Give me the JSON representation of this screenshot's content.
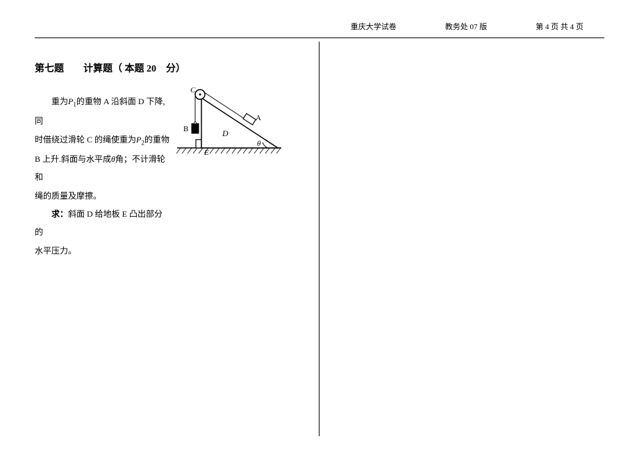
{
  "header": {
    "university": "重庆大学试卷",
    "edition": "教务处 07 版",
    "page_info": "第 4 页 共 4 页"
  },
  "question": {
    "title": "第七题　　计算题（ 本题 20　分）",
    "line1_pre": "重为",
    "line1_p": "P",
    "line1_sub1": "1",
    "line1_post": "的重物 A 沿斜面 D 下降,同",
    "line2_pre": "时借绕过滑轮 C 的绳使重为",
    "line2_p2": "P",
    "line2_sub2": "2",
    "line2_post": "的重物",
    "line3_pre": "B 上升.斜面与水平成",
    "line3_theta": "θ",
    "line3_post": "角；不计滑轮和",
    "line4": "绳的质量及摩擦。",
    "line5_label": "求：",
    "line5_text": "斜面 D 给地板 E 凸出部分的",
    "line6": "水平压力。"
  },
  "diagram_labels": {
    "A": "A",
    "B": "B",
    "C": "C",
    "D": "D",
    "E": "E",
    "theta": "θ"
  }
}
